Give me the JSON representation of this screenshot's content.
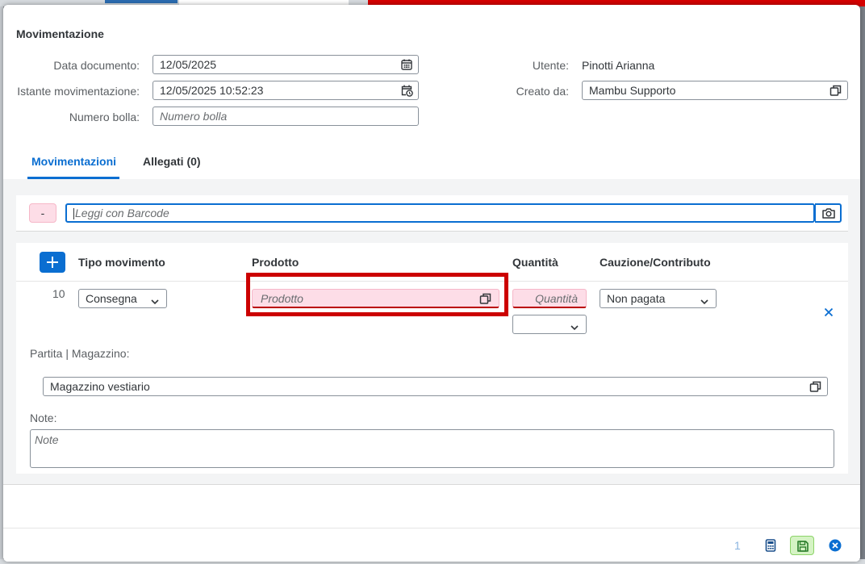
{
  "dialog": {
    "title": "Movimentazione"
  },
  "header_form": {
    "data_documento": {
      "label": "Data documento:",
      "value": "12/05/2025"
    },
    "istante_movimentazione": {
      "label": "Istante movimentazione:",
      "value": "12/05/2025 10:52:23"
    },
    "numero_bolla": {
      "label": "Numero bolla:",
      "placeholder": "Numero bolla"
    },
    "utente": {
      "label": "Utente:",
      "value": "Pinotti Arianna"
    },
    "creato_da": {
      "label": "Creato da:",
      "value": "Mambu Supporto"
    }
  },
  "tabs": [
    {
      "label": "Movimentazioni",
      "active": true
    },
    {
      "label": "Allegati (0)",
      "active": false
    }
  ],
  "barcode": {
    "minus_label": "-",
    "placeholder": "Leggi con Barcode"
  },
  "table": {
    "columns": [
      "Tipo movimento",
      "Prodotto",
      "Quantità",
      "Cauzione/Contributo"
    ],
    "row": {
      "number": "10",
      "tipo_movimento": "Consegna",
      "prodotto_placeholder": "Prodotto",
      "quantita_placeholder": "Quantità",
      "unit_value": "",
      "cauzione": "Non pagata"
    },
    "partita_label": "Partita | Magazzino:",
    "magazzino_value": "Magazzino vestiario",
    "note_label": "Note:",
    "note_placeholder": "Note"
  },
  "footer": {
    "page_number": "1"
  },
  "colors": {
    "accent": "#0a6ed1",
    "error_pink": "#fddde7",
    "highlight_red": "#cc0000",
    "save_green": "#d5f3c4"
  }
}
